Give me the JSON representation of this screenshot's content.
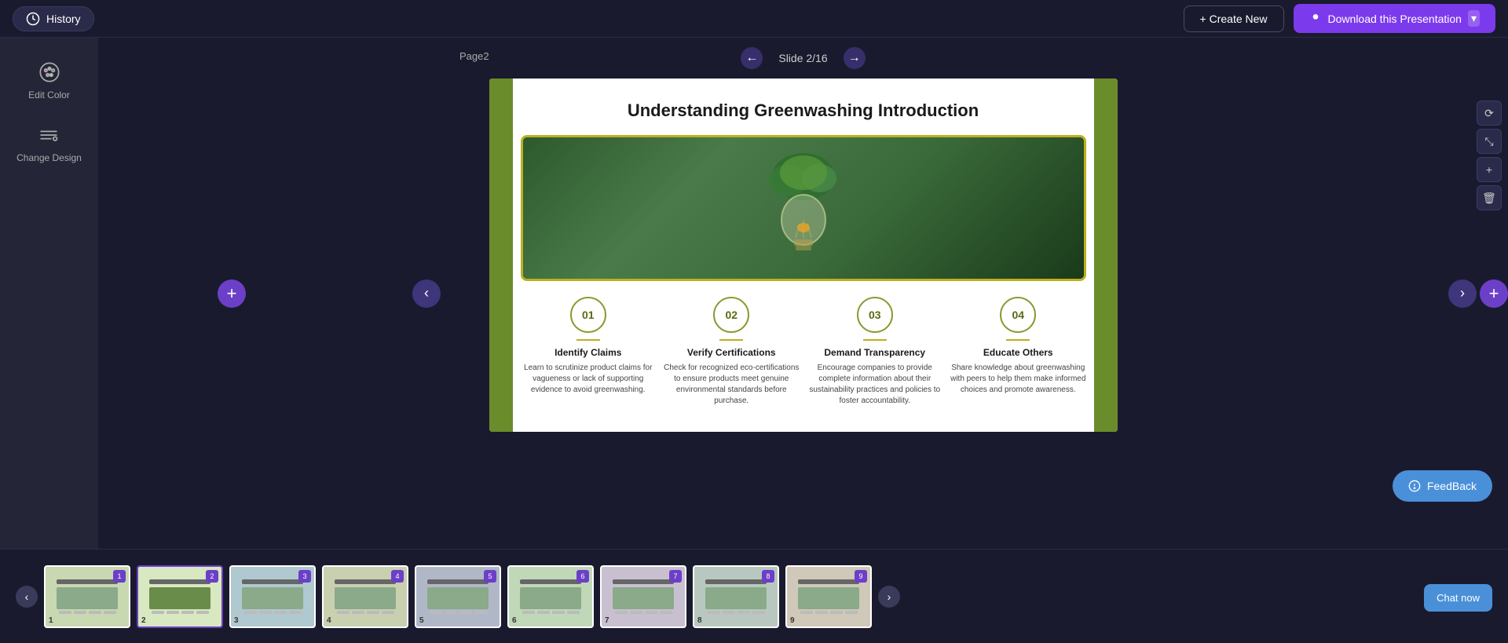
{
  "topbar": {
    "history_label": "History",
    "create_new_label": "+ Create New",
    "download_label": "Download this Presentation"
  },
  "sidebar": {
    "edit_color_label": "Edit Color",
    "change_design_label": "Change Design"
  },
  "slide_nav": {
    "page_label": "Page2",
    "slide_indicator": "Slide 2/16"
  },
  "slide": {
    "title": "Understanding Greenwashing Introduction",
    "cols": [
      {
        "number": "01",
        "title": "Identify Claims",
        "desc": "Learn to scrutinize product claims for vagueness or lack of supporting evidence to avoid greenwashing."
      },
      {
        "number": "02",
        "title": "Verify Certifications",
        "desc": "Check for recognized eco-certifications to ensure products meet genuine environmental standards before purchase."
      },
      {
        "number": "03",
        "title": "Demand Transparency",
        "desc": "Encourage companies to provide complete information about their sustainability practices and policies to foster accountability."
      },
      {
        "number": "04",
        "title": "Educate Others",
        "desc": "Share knowledge about greenwashing with peers to help them make informed choices and promote awareness."
      }
    ]
  },
  "thumbnails": [
    {
      "number": "1",
      "badge": "1"
    },
    {
      "number": "2",
      "badge": "2"
    },
    {
      "number": "3",
      "badge": "3"
    },
    {
      "number": "4",
      "badge": "4"
    },
    {
      "number": "5",
      "badge": "5"
    },
    {
      "number": "6",
      "badge": "6"
    },
    {
      "number": "7",
      "badge": "7"
    },
    {
      "number": "8",
      "badge": "8"
    },
    {
      "number": "9",
      "badge": "9"
    }
  ],
  "feedback": {
    "label": "FeedBack"
  },
  "chat": {
    "label": "Chat now"
  }
}
